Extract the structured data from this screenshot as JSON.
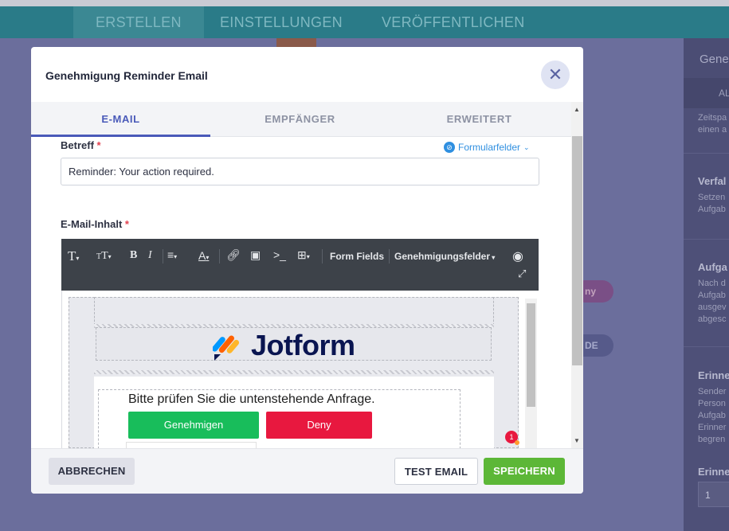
{
  "background": {
    "nav_tabs": [
      "ERSTELLEN",
      "EINSTELLUNGEN",
      "VERÖFFENTLICHEN"
    ],
    "right_panel": {
      "heading": "Gene",
      "subtab": "AL",
      "blocks": [
        {
          "title": "",
          "lines": [
            "Zeitspa",
            "einen a"
          ]
        },
        {
          "title": "Verfal",
          "lines": [
            "Setzen",
            "Aufgab"
          ]
        },
        {
          "title": "Aufga",
          "lines": [
            "Nach d",
            "Aufgab",
            "ausgev",
            "abgesc"
          ]
        },
        {
          "title": "Erinne",
          "lines": [
            "Sender",
            "Person",
            "Aufgab",
            "Erinner",
            "begren"
          ]
        },
        {
          "title": "Erinne",
          "lines": []
        }
      ],
      "input_value": "1"
    },
    "pills": [
      "ny",
      "DE"
    ]
  },
  "modal": {
    "title": "Genehmigung Reminder Email",
    "close_symbol": "✕",
    "tabs": [
      {
        "label": "E-MAIL",
        "active": true
      },
      {
        "label": "EMPFÄNGER",
        "active": false
      },
      {
        "label": "ERWEITERT",
        "active": false
      }
    ],
    "subject": {
      "label": "Betreff",
      "required_mark": "*",
      "value": "Reminder: Your action required.",
      "form_fields_link": "Formularfelder"
    },
    "content": {
      "label": "E-Mail-Inhalt",
      "required_mark": "*",
      "toolbar": {
        "form_fields": "Form Fields",
        "approval_fields": "Genehmigungsfelder"
      },
      "email": {
        "logo_text": "Jotform",
        "body_text": "Bitte prüfen Sie die untenstehende Anfrage.",
        "approve_label": "Genehmigen",
        "deny_label": "Deny",
        "notification_count": "1"
      }
    },
    "footer": {
      "cancel_label": "ABBRECHEN",
      "test_label": "TEST EMAIL",
      "save_label": "SPEICHERN"
    }
  },
  "colors": {
    "accent": "#4a5ab9",
    "approve": "#18bd5b",
    "deny": "#e8183f",
    "save": "#5cb737"
  }
}
